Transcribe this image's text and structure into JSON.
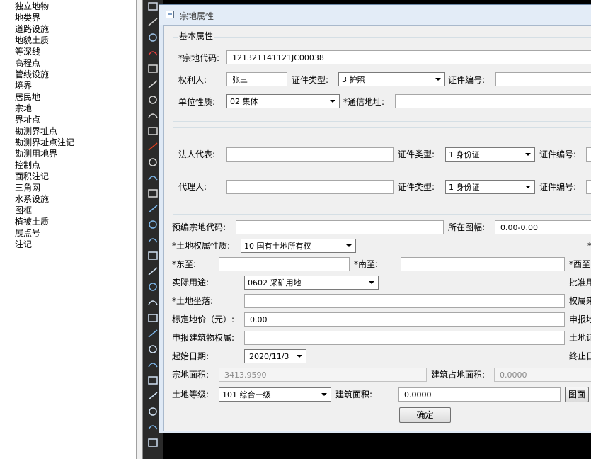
{
  "layer_list": [
    "独立地物",
    "地类界",
    "道路设施",
    "地貌土质",
    "等深线",
    "高程点",
    "管线设施",
    "境界",
    "居民地",
    "宗地",
    "界址点",
    "勘测界址点",
    "勘测界址点注记",
    "勘测用地界",
    "控制点",
    "面积注记",
    "三角网",
    "水系设施",
    "图框",
    "植被土质",
    "展点号",
    "注记"
  ],
  "toolbar_icons": [
    "grid-icon",
    "wave-icon",
    "layer-icon",
    "annotation-icon",
    "polyline-icon",
    "rectangle-icon",
    "hatch-icon",
    "parallel-icon",
    "bracket-icon",
    "text-icon",
    "circle-icon",
    "line-icon",
    "spline-icon",
    "diagonal-icon",
    "move-icon",
    "curve-icon",
    "polygon-icon",
    "rect2-icon",
    "arc-icon",
    "ellipse-icon",
    "cloud-icon",
    "spiral-icon",
    "block-icon",
    "point-icon",
    "trim-icon",
    "insert-icon",
    "table-icon",
    "cross-icon",
    "frame-icon"
  ],
  "dialog": {
    "title": "宗地属性",
    "basic_group": "基本属性",
    "parcel_code_label": "*宗地代码:",
    "parcel_code_value": "121321141121JC00038",
    "owner_label": "权利人:",
    "owner_value": "张三",
    "id_type_label": "证件类型:",
    "id_type_value": "3 护照",
    "id_number_label": "证件编号:",
    "id_number_value": "",
    "unit_nature_label": "单位性质:",
    "unit_nature_value": "02 集体",
    "mail_address_label": "*通信地址:",
    "mail_address_value": "",
    "legal_rep_label": "法人代表:",
    "legal_rep_value": "",
    "legal_id_type_label": "证件类型:",
    "legal_id_type_value": "1 身份证",
    "legal_id_number_label": "证件编号:",
    "agent_label": "代理人:",
    "agent_value": "",
    "agent_id_type_label": "证件类型:",
    "agent_id_type_value": "1 身份证",
    "agent_id_number_label": "证件编号:",
    "pre_code_label": "预编宗地代码:",
    "pre_code_value": "",
    "map_sheet_label": "所在图幅:",
    "map_sheet_value": "0.00-0.00",
    "land_right_label": "*土地权属性质:",
    "land_right_value": "10 国有土地所有权",
    "right_edge_star": "*",
    "east_label": "*东至:",
    "east_value": "",
    "south_label": "*南至:",
    "south_value": "",
    "west_label": "*西至",
    "actual_use_label": "实际用途:",
    "actual_use_value": "0602 采矿用地",
    "approved_use_label": "批准用",
    "location_label": "*土地坐落:",
    "location_value": "",
    "ownership_source_label": "权属来",
    "land_price_label": "标定地价（元）:",
    "land_price_value": "0.00",
    "declared_price_label": "申报地",
    "declared_building_label": "申报建筑物权属:",
    "declared_building_value": "",
    "land_cert_label": "土地证",
    "start_date_label": "起始日期:",
    "start_date_value": "2020/11/3",
    "end_date_label": "终止日",
    "parcel_area_label": "宗地面积:",
    "parcel_area_value": "3413.9590",
    "building_footprint_label": "建筑占地面积:",
    "building_footprint_value": "0.0000",
    "land_grade_label": "土地等级:",
    "land_grade_value": "101 综合一级",
    "building_area_label": "建筑面积:",
    "building_area_value": "0.0000",
    "drawing_button": "图面",
    "ok_button": "确定"
  }
}
